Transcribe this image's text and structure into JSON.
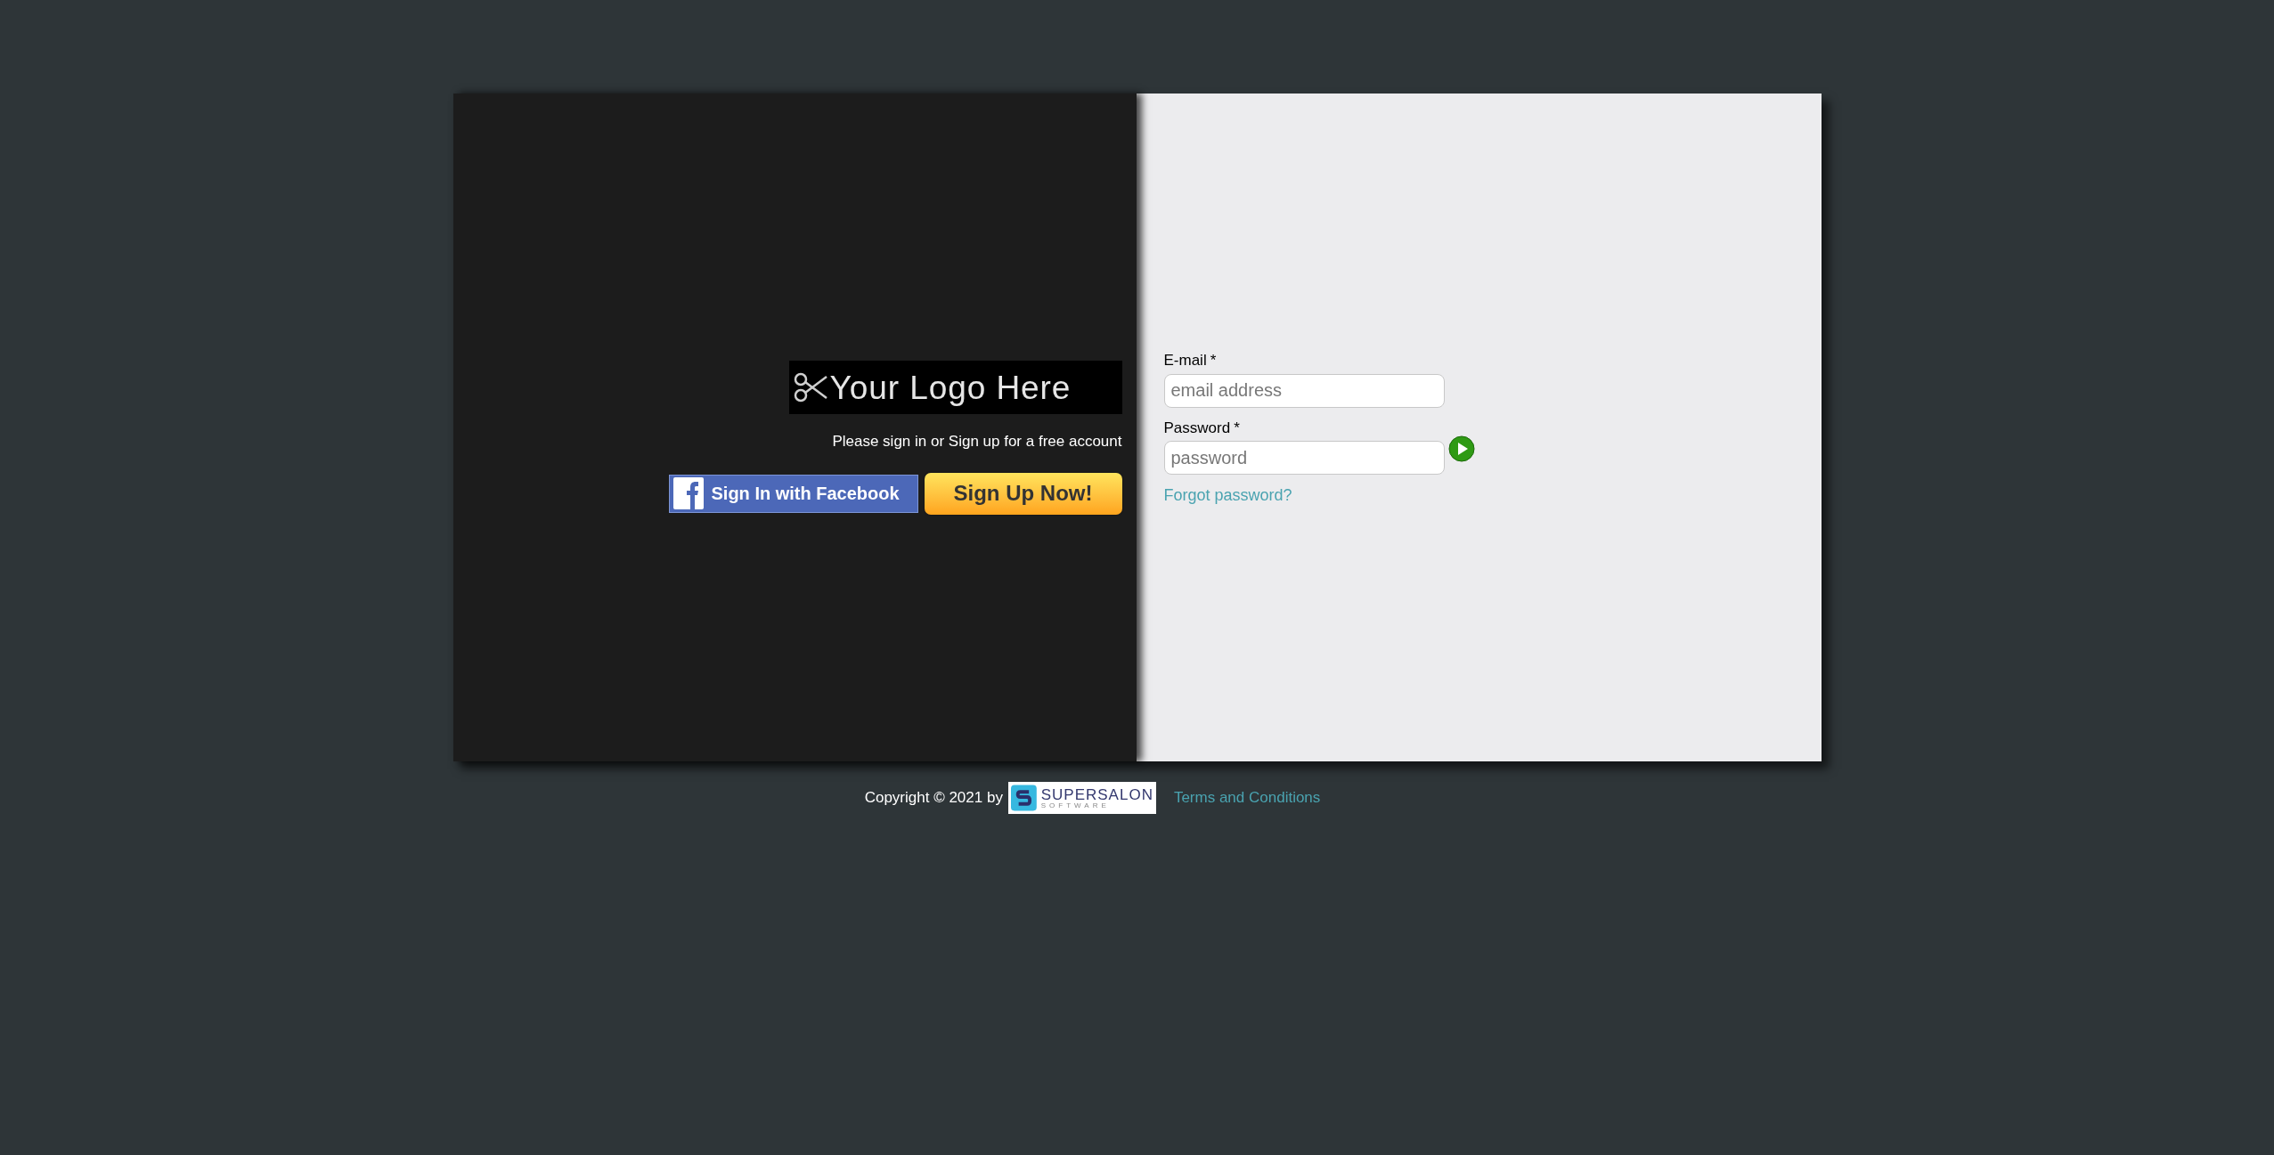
{
  "left_panel": {
    "logo_text": "Your Logo Here",
    "prompt": "Please sign in or Sign up for a free account",
    "facebook_button": "Sign In with Facebook",
    "signup_button": "Sign Up Now!"
  },
  "login_form": {
    "email_label": "E-mail",
    "email_required": "*",
    "email_placeholder": "email address",
    "password_label": "Password",
    "password_required": "*",
    "password_placeholder": "password",
    "forgot_link": "Forgot password?"
  },
  "footer": {
    "copyright": "Copyright © 2021 by",
    "brand_name": "SUPERSALON",
    "brand_tagline": "SOFTWARE",
    "terms_link": "Terms and Conditions"
  }
}
